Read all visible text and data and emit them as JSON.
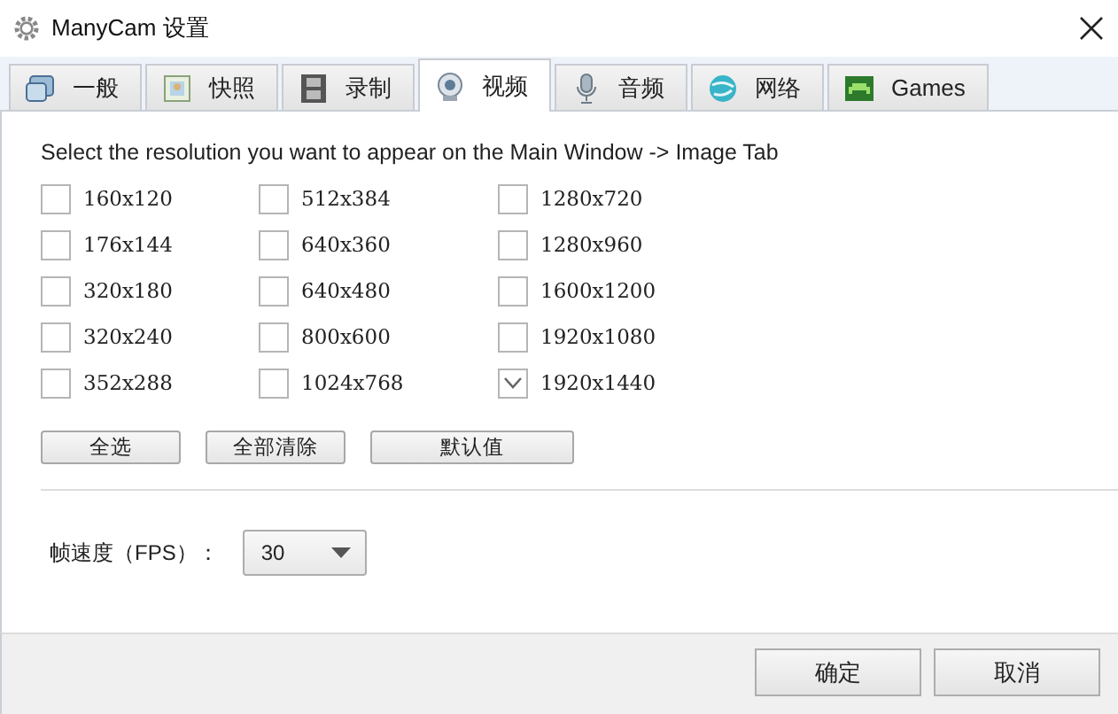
{
  "window": {
    "title": "ManyCam 设置"
  },
  "tabs": [
    {
      "label": "一般",
      "selected": false
    },
    {
      "label": "快照",
      "selected": false
    },
    {
      "label": "录制",
      "selected": false
    },
    {
      "label": "视频",
      "selected": true
    },
    {
      "label": "音频",
      "selected": false
    },
    {
      "label": "网络",
      "selected": false
    },
    {
      "label": "Games",
      "selected": false
    }
  ],
  "instruction": "Select the resolution you want to appear on the Main Window -> Image Tab",
  "resolution_columns": [
    [
      {
        "label": "160x120",
        "checked": false
      },
      {
        "label": "176x144",
        "checked": false
      },
      {
        "label": "320x180",
        "checked": false
      },
      {
        "label": "320x240",
        "checked": false
      },
      {
        "label": "352x288",
        "checked": false
      }
    ],
    [
      {
        "label": "512x384",
        "checked": false
      },
      {
        "label": "640x360",
        "checked": false
      },
      {
        "label": "640x480",
        "checked": false
      },
      {
        "label": "800x600",
        "checked": false
      },
      {
        "label": "1024x768",
        "checked": false
      }
    ],
    [
      {
        "label": "1280x720",
        "checked": false
      },
      {
        "label": "1280x960",
        "checked": false
      },
      {
        "label": "1600x1200",
        "checked": false
      },
      {
        "label": "1920x1080",
        "checked": false
      },
      {
        "label": "1920x1440",
        "checked": true
      }
    ]
  ],
  "selection_buttons": [
    "全选",
    "全部清除",
    "默认值"
  ],
  "fps": {
    "label": "帧速度（FPS）：",
    "value": "30"
  },
  "buttons": [
    "确定",
    "取消"
  ]
}
